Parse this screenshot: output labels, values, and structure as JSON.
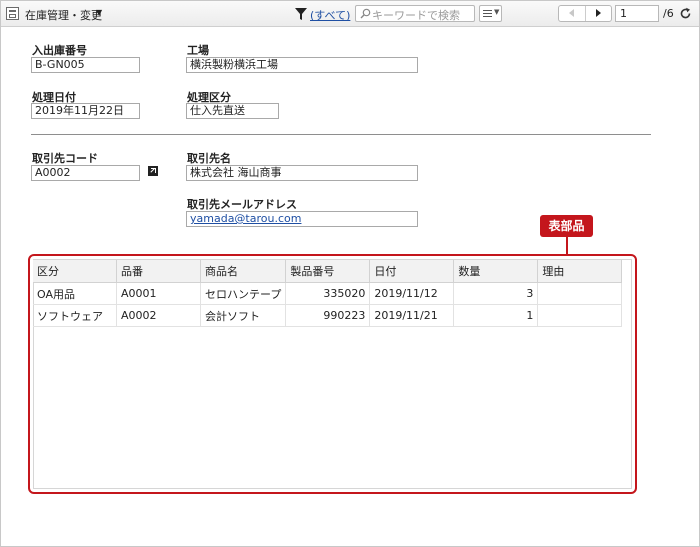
{
  "toolbar": {
    "view_title": "在庫管理・変更",
    "filter_label": "(すべて)",
    "search_placeholder": "キーワードで検索",
    "page_current": "1",
    "page_total": "/6"
  },
  "form": {
    "receipt_number": {
      "label": "入出庫番号",
      "value": "B-GN005"
    },
    "factory": {
      "label": "工場",
      "value": "横浜製粉横浜工場"
    },
    "process_date": {
      "label": "処理日付",
      "value": "2019年11月22日"
    },
    "process_type": {
      "label": "処理区分",
      "value": "仕入先直送"
    },
    "partner_code": {
      "label": "取引先コード",
      "value": "A0002"
    },
    "partner_name": {
      "label": "取引先名",
      "value": "株式会社 海山商事"
    },
    "partner_email": {
      "label": "取引先メールアドレス",
      "value": "yamada@tarou.com"
    }
  },
  "callout": {
    "label": "表部品"
  },
  "table": {
    "headers": [
      "区分",
      "品番",
      "商品名",
      "製品番号",
      "日付",
      "数量",
      "理由"
    ],
    "rows": [
      [
        "OA用品",
        "A0001",
        "セロハンテープ",
        "335020",
        "2019/11/12",
        "3",
        ""
      ],
      [
        "ソフトウェア",
        "A0002",
        "会計ソフト",
        "990223",
        "2019/11/21",
        "1",
        ""
      ]
    ]
  },
  "colors": {
    "accent_red": "#c4161c",
    "link_blue": "#1f4fa3"
  }
}
